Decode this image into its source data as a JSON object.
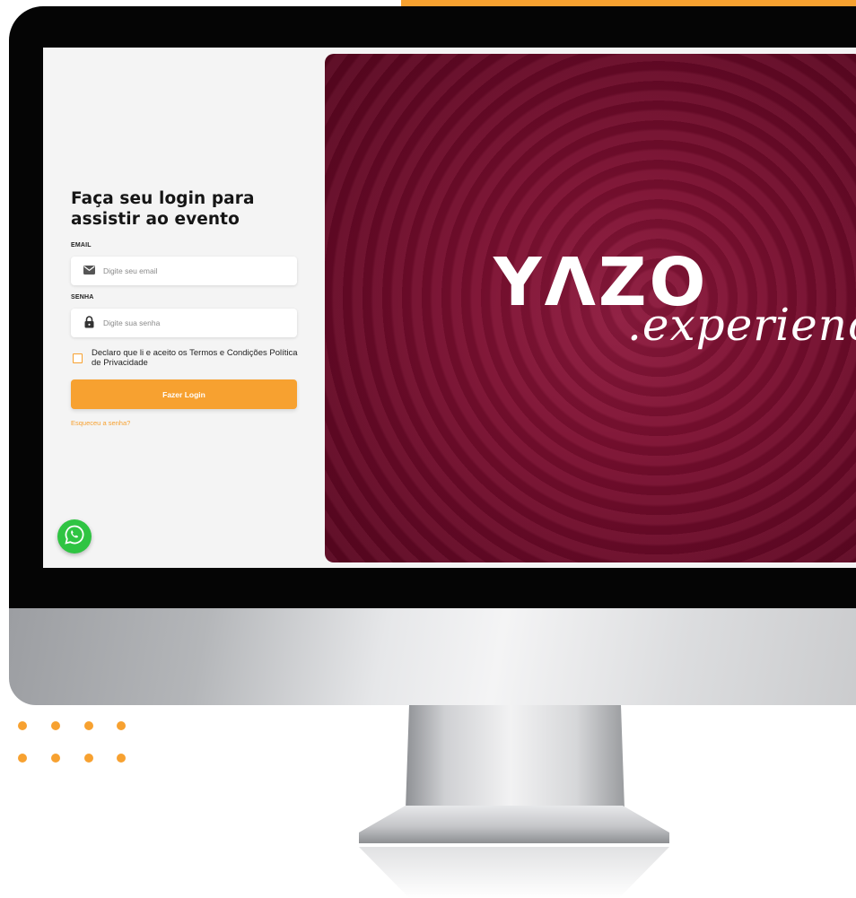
{
  "login": {
    "title": "Faça seu login para assistir ao evento",
    "email_label": "EMAIL",
    "email_placeholder": "Digite seu email",
    "email_value": "",
    "password_label": "SENHA",
    "password_placeholder": "Digite sua senha",
    "password_value": "",
    "terms_text": "Declaro que li e aceito os Termos e Condições Política de Privacidade",
    "terms_checked": false,
    "submit_label": "Fazer Login",
    "forgot_label": "Esqueceu a senha?"
  },
  "hero": {
    "logo_text": "YΛZO",
    "logo_script": ".experienc"
  },
  "icons": {
    "email": "envelope-icon",
    "password": "lock-icon",
    "chat": "whatsapp-icon"
  },
  "colors": {
    "accent": "#f7a130",
    "hero_background": "#7c0f30",
    "panel_background": "#f4f4f4",
    "whatsapp": "#2fc442"
  }
}
